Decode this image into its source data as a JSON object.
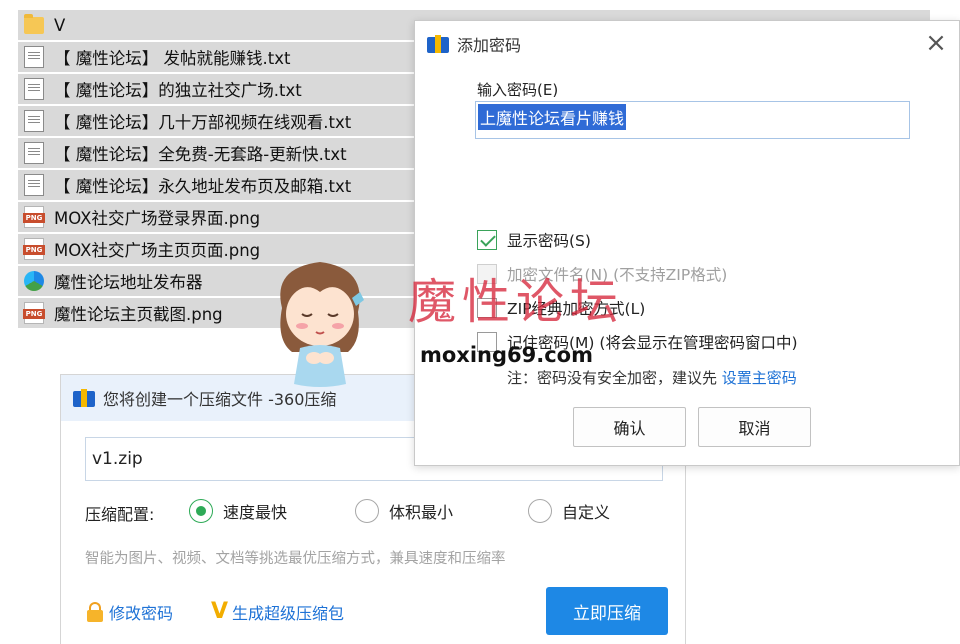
{
  "file_list": [
    {
      "icon": "folder-icon",
      "name": "V"
    },
    {
      "icon": "text-file-icon",
      "name": "【 魔性论坛】 发帖就能赚钱.txt"
    },
    {
      "icon": "text-file-icon",
      "name": "【 魔性论坛】的独立社交广场.txt"
    },
    {
      "icon": "text-file-icon",
      "name": "【 魔性论坛】几十万部视频在线观看.txt"
    },
    {
      "icon": "text-file-icon",
      "name": "【 魔性论坛】全免费-无套路-更新快.txt"
    },
    {
      "icon": "text-file-icon",
      "name": "【 魔性论坛】永久地址发布页及邮箱.txt"
    },
    {
      "icon": "png-file-icon",
      "name": "MOX社交广场登录界面.png"
    },
    {
      "icon": "png-file-icon",
      "name": "MOX社交广场主页页面.png"
    },
    {
      "icon": "app-exe-icon",
      "name": "魔性论坛地址发布器"
    },
    {
      "icon": "png-file-icon",
      "name": "魔性论坛主页截图.png"
    }
  ],
  "png_badge": "PNG",
  "password_dialog": {
    "title": "添加密码",
    "close_symbol": "×",
    "input_label": "输入密码(E)",
    "password_value": "上魔性论坛看片赚钱",
    "options": [
      {
        "label": "显示密码(S)",
        "checked": true,
        "disabled": false
      },
      {
        "label": "加密文件名(N) (不支持ZIP格式)",
        "checked": false,
        "disabled": true
      },
      {
        "label": "ZIP经典加密方式(L)",
        "checked": false,
        "disabled": false
      },
      {
        "label": "记住密码(M) (将会显示在管理密码窗口中)",
        "checked": false,
        "disabled": false
      }
    ],
    "note_prefix": "注：密码没有安全加密，建议先 ",
    "note_link": "设置主密码",
    "ok_label": "确认",
    "cancel_label": "取消"
  },
  "compress_dialog": {
    "title": "您将创建一个压缩文件 -360压缩",
    "filename": "v1.zip",
    "config_label": "压缩配置:",
    "modes": [
      {
        "label": "速度最快",
        "selected": true
      },
      {
        "label": "体积最小",
        "selected": false
      },
      {
        "label": "自定义",
        "selected": false
      }
    ],
    "hint": "智能为图片、视频、文档等挑选最优压缩方式，兼具速度和压缩率",
    "change_password_label": "修改密码",
    "super_pack_icon": "V",
    "super_pack_label": "生成超级压缩包",
    "compress_now_label": "立即压缩"
  },
  "watermark": {
    "text": "魔性论坛",
    "url": "moxing69.com"
  },
  "colors": {
    "accent_blue": "#1e88e5",
    "check_green": "#2eaa57",
    "link_blue": "#1e72d6",
    "watermark_red": "#d6283c"
  }
}
